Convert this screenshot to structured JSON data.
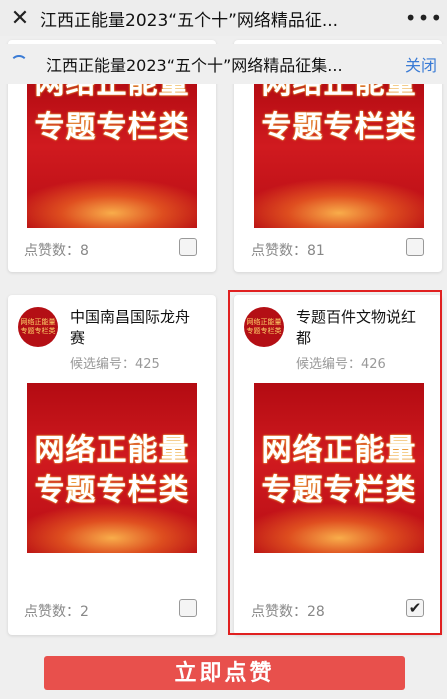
{
  "topbar": {
    "title": "江西正能量2023“五个十”网络精品征...",
    "close_glyph": "✕",
    "more_glyph": "•••"
  },
  "subbar": {
    "title": "江西正能量2023“五个十”网络精品征集...",
    "close_label": "关闭"
  },
  "poster": {
    "line1": "网络正能量",
    "line2": "专题专栏类"
  },
  "avatar_text": {
    "line1": "网络正能量",
    "line2": "专题专栏类"
  },
  "cards": [
    {
      "likes": "点赞数：8",
      "checked": false
    },
    {
      "likes": "点赞数：81",
      "checked": false
    },
    {
      "name": "中国南昌国际龙舟赛",
      "name_line1": "中国南昌国际龙舟",
      "name_line2": "赛",
      "candidate": "候选编号：425",
      "likes": "点赞数：2",
      "checked": false
    },
    {
      "name": "专题百件文物说红都",
      "name_line1": "专题百件文物说红",
      "name_line2": "都",
      "candidate": "候选编号：426",
      "likes": "点赞数：28",
      "checked": true,
      "check_glyph": "✔"
    }
  ],
  "bottom_button": "立即点赞",
  "colors": {
    "accent_blue": "#3a7bd5",
    "button_red": "#e8504c",
    "poster_red": "#c8141b",
    "highlight_border": "#e02020"
  }
}
